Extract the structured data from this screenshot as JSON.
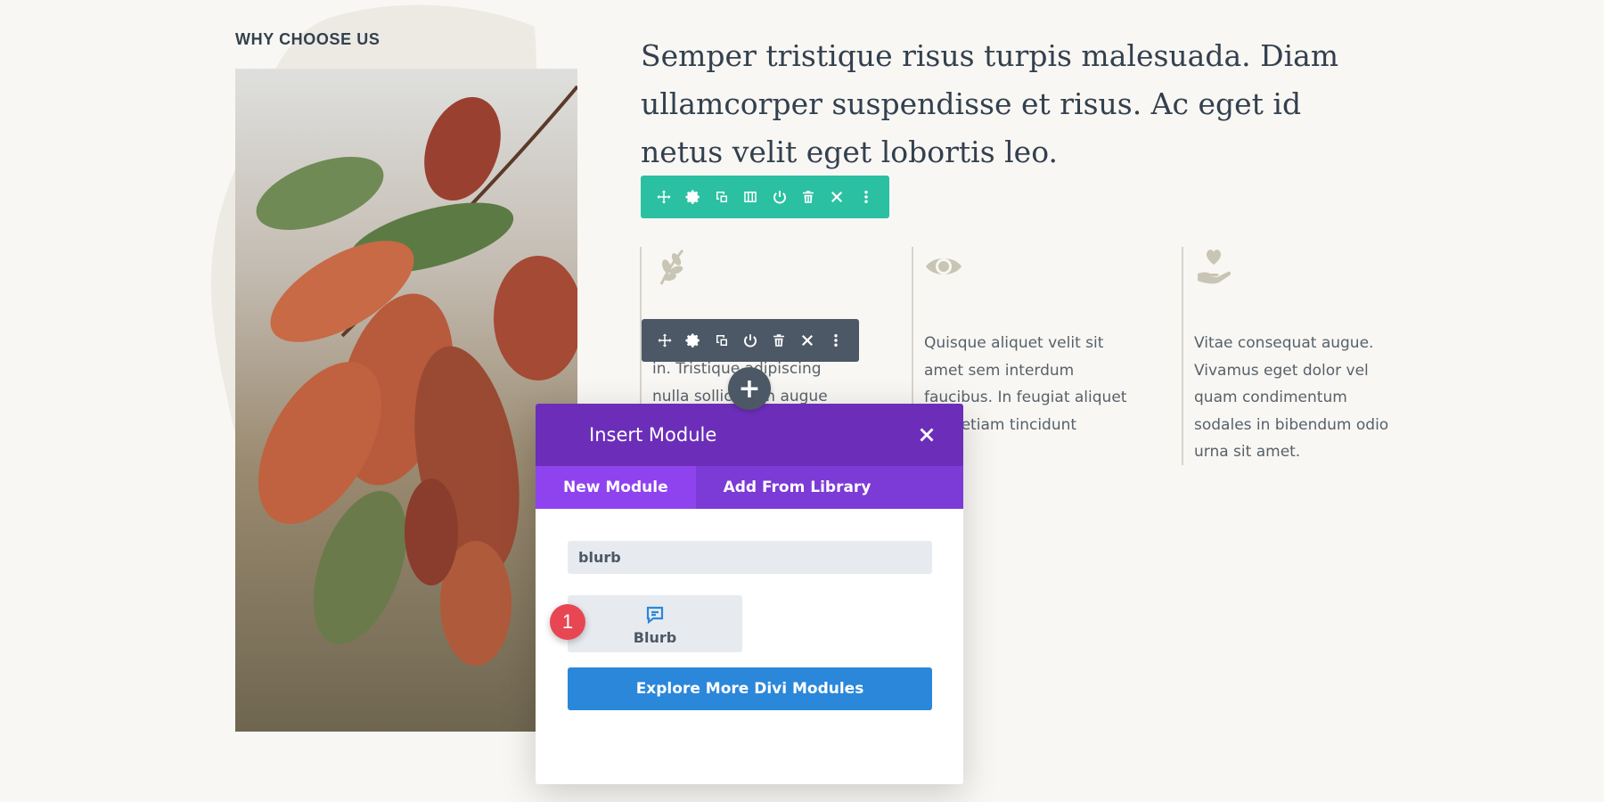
{
  "section": {
    "eyebrow": "WHY CHOOSE US",
    "headline": "Semper tristique risus turpis malesuada. Diam ullamcorper suspendisse et risus. Ac eget id netus velit eget lobortis leo."
  },
  "row_toolbar": {
    "icons": [
      "move-icon",
      "gear-icon",
      "duplicate-icon",
      "columns-icon",
      "power-icon",
      "trash-icon",
      "close-icon",
      "more-icon"
    ]
  },
  "module_toolbar": {
    "icons": [
      "move-icon",
      "gear-icon",
      "duplicate-icon",
      "power-icon",
      "trash-icon",
      "close-icon",
      "more-icon"
    ]
  },
  "blurbs": [
    {
      "icon": "leaf-icon",
      "text": "in. Tristique adipiscing nulla sollicitudin augue"
    },
    {
      "icon": "eye-icon",
      "text": "Quisque aliquet velit sit amet sem interdum faucibus. In feugiat aliquet mus etiam tincidunt"
    },
    {
      "icon": "heart-hand-icon",
      "text": "Vitae consequat augue. Vivamus eget dolor vel quam condimentum sodales in bibendum odio urna sit amet."
    }
  ],
  "modal": {
    "title": "Insert Module",
    "tabs": [
      {
        "label": "New Module",
        "active": true
      },
      {
        "label": "Add From Library",
        "active": false
      }
    ],
    "search": {
      "value": "blurb"
    },
    "results": [
      {
        "label": "Blurb",
        "icon": "chat-icon"
      }
    ],
    "step_badge": "1",
    "explore_label": "Explore More Divi Modules"
  },
  "colors": {
    "page_bg": "#f9f7f3",
    "row_toolbar": "#2bc0a1",
    "module_toolbar": "#4c5866",
    "modal_header": "#6c2eb9",
    "modal_tabs": "#7c3ad6",
    "active_tab": "#8f43ee",
    "explore_button": "#2b87da",
    "badge": "#e84653",
    "icon_tint": "#c9c5b4"
  }
}
